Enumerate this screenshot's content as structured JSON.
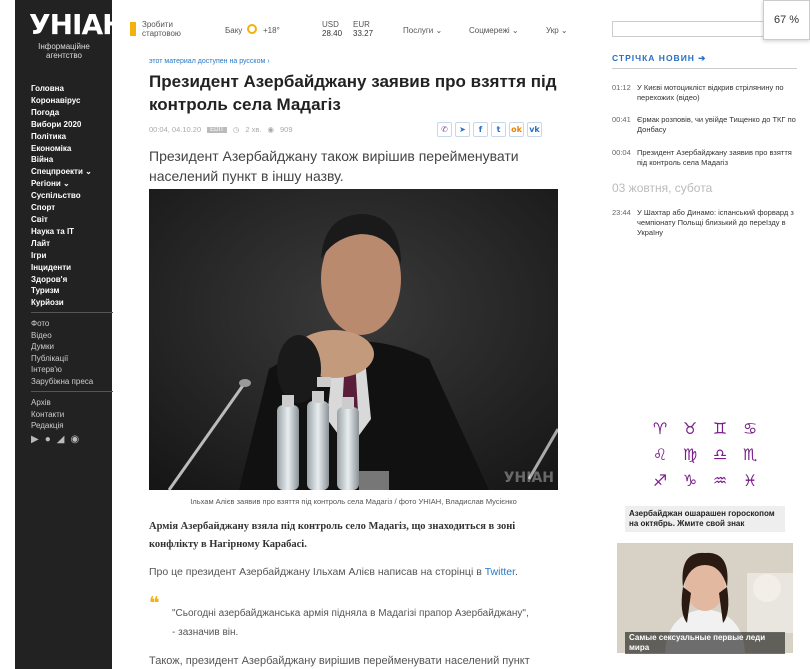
{
  "sidebar": {
    "logo": "УНІАН",
    "logo_sub": "Інформаційне агентство",
    "nav": [
      "Головна",
      "Коронавірус",
      "Погода",
      "Вибори 2020",
      "Політика",
      "Економіка",
      "Війна",
      "Спецпроекти ⌄",
      "Регіони ⌄",
      "Суспільство",
      "Спорт",
      "Світ",
      "Наука та IT",
      "Лайт",
      "Ігри",
      "Інциденти",
      "Здоров'я",
      "Туризм",
      "Курйози"
    ],
    "nav2": [
      "Фото",
      "Відео",
      "Думки",
      "Публікації",
      "Інтерв'ю",
      "Зарубіжна преса"
    ],
    "nav3": [
      "Архів",
      "Контакти",
      "Редакція"
    ],
    "social_icons": [
      "play-icon",
      "apple-icon",
      "rss-icon",
      "chat-icon"
    ]
  },
  "topbar": {
    "homepage": "Зробити стартовою",
    "city": "Баку",
    "temp": "+18°",
    "usd_label": "USD",
    "usd": "28.40",
    "eur_label": "EUR",
    "eur": "33.27",
    "services": "Послуги ⌄",
    "social": "Соцмережі ⌄",
    "lang": "Укр ⌄"
  },
  "zoom": "67 %",
  "article": {
    "lang_note": "этот материал доступен на русском ›",
    "title": "Президент Азербайджану заявив про взяття під контроль села Мадагіз",
    "datetime": "00:04, 04.10.20",
    "tag": "EDIT",
    "read_time": "2 хв.",
    "views": "909",
    "share_icons": [
      "viber-icon",
      "telegram-icon",
      "facebook-icon",
      "twitter-icon",
      "odnoklassniki-icon",
      "vk-icon"
    ],
    "lead": "Президент Азербайджану також вирішив перейменувати населений пункт в іншу назву.",
    "caption": "Ільхам Алієв заявив про взяття під контроль села Мадагіз / фото УНІАН, Владислав Мусієнко",
    "watermark": "УНІАН",
    "p1": "Армія Азербайджану взяла під контроль село Мадагіз, що знаходиться в зоні конфлікту в Нагірному Карабасі.",
    "p2_prefix": "Про це президент Азербайджану Ільхам Алієв написав на сторінці в ",
    "p2_link": "Twitter",
    "p2_suffix": ".",
    "quote": "\"Сьогодні азербайджанська армія підняла в Мадагізі прапор Азербайджану\", - зазначив він.",
    "p3": "Також, президент Азербайджану вирішив перейменувати населений пункт"
  },
  "right": {
    "news_head": "СТРІЧКА НОВИН ➔",
    "news": [
      {
        "time": "01:12",
        "text": "У Києві мотоцикліст відкрив стрілянину по перехожих (відео)"
      },
      {
        "time": "00:41",
        "text": "Єрмак розповів, чи увійде Тищенко до ТКГ по Донбасу"
      },
      {
        "time": "00:04",
        "text": "Президент Азербайджану заявив про взяття під контроль села Мадагіз"
      }
    ],
    "date_head": "03 жовтня, субота",
    "news2": [
      {
        "time": "23:44",
        "text": "У Шахтар або Динамо: іспанський форвард з чемпіонату Польщі близький до переїзду в Україну"
      }
    ],
    "ad1_signs": [
      "♈",
      "♉",
      "♊",
      "♋",
      "♌",
      "♍",
      "♎",
      "♏",
      "♐",
      "♑",
      "♒",
      "♓"
    ],
    "ad1_caption": "Азербайджан ошарашен гороскопом на октябрь. Жмите свой знак",
    "ad2_caption": "Самые сексуальные первые леди мира"
  }
}
